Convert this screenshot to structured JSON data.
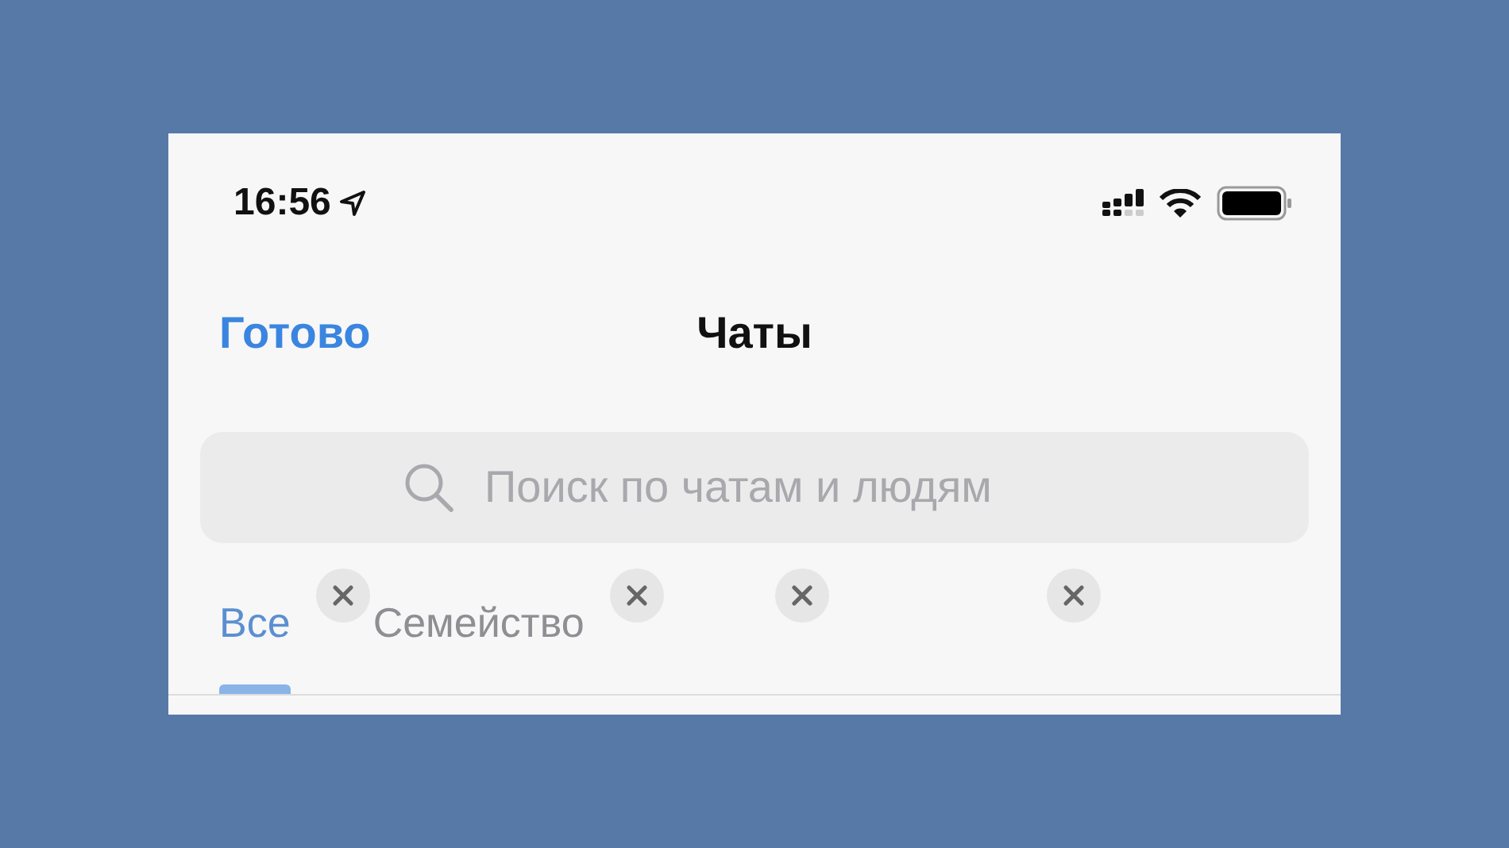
{
  "status_bar": {
    "time": "16:56",
    "location_on": true
  },
  "nav": {
    "done": "Готово",
    "title": "Чаты"
  },
  "search": {
    "placeholder": "Поиск по чатам и людям"
  },
  "tabs": [
    {
      "label": "Все",
      "selected": true,
      "removable": false
    },
    {
      "label": "Семейство",
      "selected": false,
      "removable": true
    },
    {
      "removable": true
    },
    {
      "removable": true
    },
    {
      "removable": true
    }
  ]
}
